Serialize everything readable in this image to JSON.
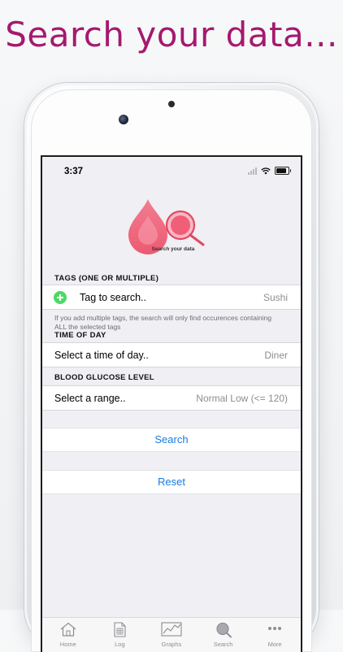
{
  "headline": "Search your data...",
  "status_bar": {
    "time": "3:37"
  },
  "app_logo": {
    "caption": "Search your data"
  },
  "tags_section": {
    "header": "TAGS (ONE OR MULTIPLE)",
    "tag_cell_label": "Tag to search..",
    "tag_cell_value": "Sushi",
    "footnote": "If you add multiple tags, the search will only find occurences containing ALL the selected tags"
  },
  "time_section": {
    "header": "TIME OF DAY",
    "cell_label": "Select a time of day..",
    "cell_value": "Diner"
  },
  "glucose_section": {
    "header": "BLOOD GLUCOSE LEVEL",
    "cell_label": "Select a range..",
    "cell_value": "Normal Low (<= 120)"
  },
  "actions": {
    "search_label": "Search",
    "reset_label": "Reset"
  },
  "tab_bar": {
    "items": [
      {
        "label": "Home",
        "icon": "home-icon"
      },
      {
        "label": "Log",
        "icon": "log-icon"
      },
      {
        "label": "Graphs",
        "icon": "graphs-icon"
      },
      {
        "label": "Search",
        "icon": "search-icon"
      },
      {
        "label": "More",
        "icon": "more-icon"
      }
    ],
    "selected": "Search"
  },
  "colors": {
    "headline": "#a4196f",
    "accent_blue": "#1a7adf",
    "logo_pink": "#f1637a",
    "add_green": "#4cd964"
  }
}
